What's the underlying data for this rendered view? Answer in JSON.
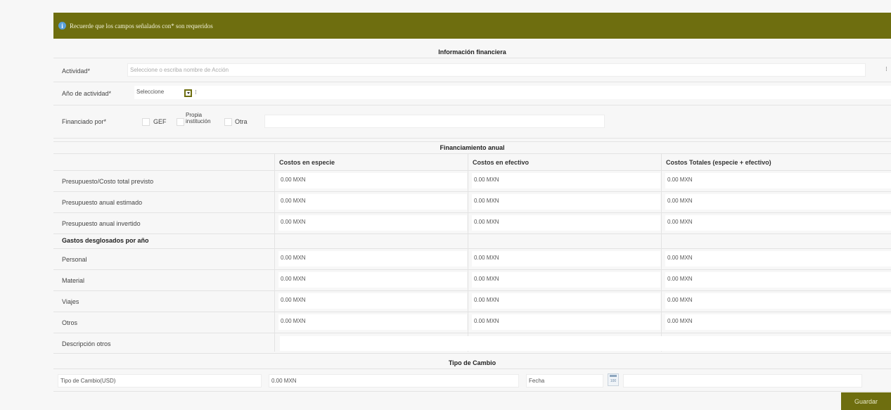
{
  "notice": {
    "text": "Recuerde que los campos señalados con* son requeridos"
  },
  "info_section": {
    "title": "Información financiera"
  },
  "actividad": {
    "label": "Actividad*",
    "placeholder": "Seleccione o escriba nombre de Acción"
  },
  "anio": {
    "label": "Año de actividad*",
    "value": "Seleccione"
  },
  "financiado": {
    "label": "Financiado por*",
    "options": [
      "GEF",
      "Propia institución",
      "Otra"
    ],
    "otra_value": ""
  },
  "financiamiento": {
    "title": "Financiamiento anual",
    "columns": [
      "Costos en especie",
      "Costos en efectivo",
      "Costos Totales (especie + efectivo)"
    ],
    "rows": [
      {
        "label": "Presupuesto/Costo total previsto",
        "values": [
          "0.00 MXN",
          "0.00 MXN",
          "0.00 MXN"
        ]
      },
      {
        "label": "Presupuesto anual estimado",
        "values": [
          "0.00 MXN",
          "0.00 MXN",
          "0.00 MXN"
        ]
      },
      {
        "label": "Presupuesto anual invertido",
        "values": [
          "0.00 MXN",
          "0.00 MXN",
          "0.00 MXN"
        ]
      }
    ],
    "gastos_header": "Gastos desglosados por año",
    "gastos": [
      {
        "label": "Personal",
        "values": [
          "0.00 MXN",
          "0.00 MXN",
          "0.00 MXN"
        ]
      },
      {
        "label": "Material",
        "values": [
          "0.00 MXN",
          "0.00 MXN",
          "0.00 MXN"
        ]
      },
      {
        "label": "Viajes",
        "values": [
          "0.00 MXN",
          "0.00 MXN",
          "0.00 MXN"
        ]
      },
      {
        "label": "Otros",
        "values": [
          "0.00 MXN",
          "0.00 MXN",
          "0.00 MXN"
        ]
      }
    ],
    "descripcion_label": "Descripción otros"
  },
  "cambio": {
    "title": "Tipo de Cambio",
    "label": "Tipo de Cambio(USD)",
    "value": "0.00 MXN",
    "fecha_label": "Fecha",
    "fecha_value": ""
  },
  "calendar_icon_text": "100",
  "actions": {
    "guardar": "Guardar"
  },
  "colors": {
    "accent": "#6e6e0f",
    "info": "#5aa0d8"
  }
}
